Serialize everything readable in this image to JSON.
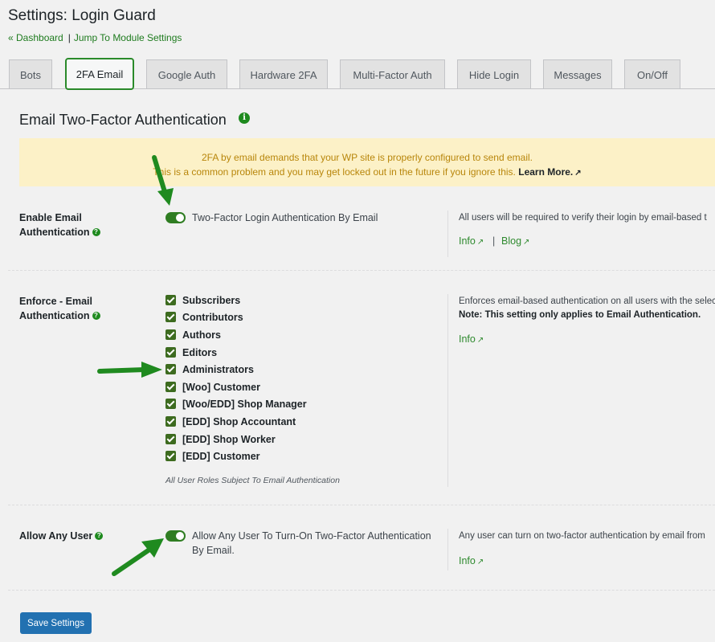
{
  "page": {
    "title": "Settings: Login Guard",
    "breadcrumbs": [
      "« Dashboard",
      "Jump To Module Settings"
    ],
    "breadcrumb_separator": "|"
  },
  "tabs": [
    {
      "label": "Bots",
      "active": false
    },
    {
      "label": "2FA Email",
      "active": true
    },
    {
      "label": "Google Auth",
      "active": false
    },
    {
      "label": "Hardware 2FA",
      "active": false
    },
    {
      "label": "Multi-Factor Auth",
      "active": false
    },
    {
      "label": "Hide Login",
      "active": false
    },
    {
      "label": "Messages",
      "active": false
    },
    {
      "label": "On/Off",
      "active": false
    }
  ],
  "section": {
    "title": "Email Two-Factor Authentication",
    "info_icon": "i"
  },
  "notice": {
    "line1": "2FA by email demands that your WP site is properly configured to send email.",
    "line2": "This is a common problem and you may get locked out in the future if you ignore this.",
    "learn_more": "Learn More."
  },
  "settings": {
    "enable": {
      "label_line1": "Enable Email",
      "label_line2": "Authentication",
      "help": "?",
      "toggle_on": true,
      "option": "Two-Factor Login Authentication By Email",
      "description": "All users will be required to verify their login by email-based t",
      "links": [
        "Info",
        "Blog"
      ],
      "link_separator": "|"
    },
    "enforce": {
      "label_line1": "Enforce - Email",
      "label_line2": "Authentication",
      "help": "?",
      "roles": [
        {
          "label": "Subscribers",
          "checked": true
        },
        {
          "label": "Contributors",
          "checked": true
        },
        {
          "label": "Authors",
          "checked": true
        },
        {
          "label": "Editors",
          "checked": true
        },
        {
          "label": "Administrators",
          "checked": true
        },
        {
          "label": "[Woo] Customer",
          "checked": true
        },
        {
          "label": "[Woo/EDD] Shop Manager",
          "checked": true
        },
        {
          "label": "[EDD] Shop Accountant",
          "checked": true
        },
        {
          "label": "[EDD] Shop Worker",
          "checked": true
        },
        {
          "label": "[EDD] Customer",
          "checked": true
        }
      ],
      "hint": "All User Roles Subject To Email Authentication",
      "description": "Enforces email-based authentication on all users with the selec",
      "note": "Note: This setting only applies to Email Authentication.",
      "links": [
        "Info"
      ]
    },
    "allow_any": {
      "label": "Allow Any User",
      "help": "?",
      "toggle_on": true,
      "option_line1": "Allow Any User To Turn-On Two-Factor Authentication",
      "option_line2": "By Email.",
      "description": "Any user can turn on two-factor authentication by email from",
      "links": [
        "Info"
      ]
    }
  },
  "save_button": "Save Settings",
  "colors": {
    "accent_green": "#2f7d22",
    "link_green": "#2f8a2f",
    "notice_bg": "#fcf1c7",
    "notice_text": "#b8860b",
    "button_blue": "#2271b1",
    "arrow_green": "#1f8a1f"
  },
  "icons": {
    "external_link": "external-link-icon",
    "info": "info-icon",
    "help": "help-icon",
    "arrow": "arrow-annotation-icon"
  }
}
